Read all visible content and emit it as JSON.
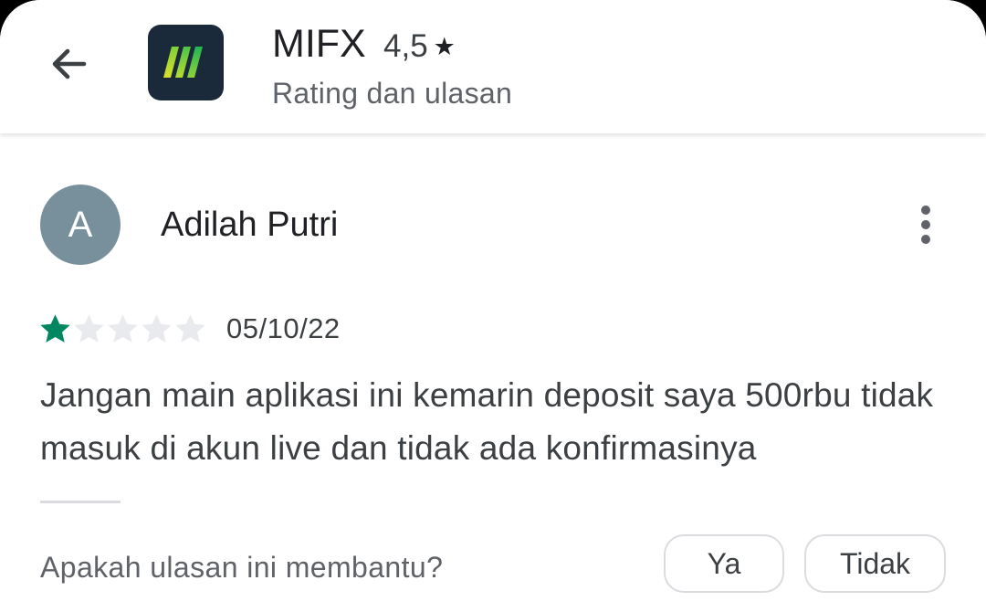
{
  "header": {
    "app_name": "MIFX",
    "rating_value": "4,5",
    "rating_star": "★",
    "subtitle": "Rating dan ulasan",
    "icon_bg": "#1b2a3b"
  },
  "review": {
    "avatar_initial": "A",
    "avatar_color": "#78909c",
    "reviewer_name": "Adilah Putri",
    "rating": 1,
    "rating_max": 5,
    "star_filled_color": "#01875f",
    "star_empty_color": "#e8eaed",
    "date": "05/10/22",
    "text": "Jangan main aplikasi ini kemarin deposit saya 500rbu tidak masuk di akun live dan tidak ada konfirmasinya"
  },
  "helpful": {
    "question": "Apakah ulasan ini membantu?",
    "yes_label": "Ya",
    "no_label": "Tidak"
  },
  "icons": {
    "back": "arrow-left-icon",
    "more": "more-vertical-icon",
    "star": "star-icon",
    "app": "mifx-app-icon"
  }
}
